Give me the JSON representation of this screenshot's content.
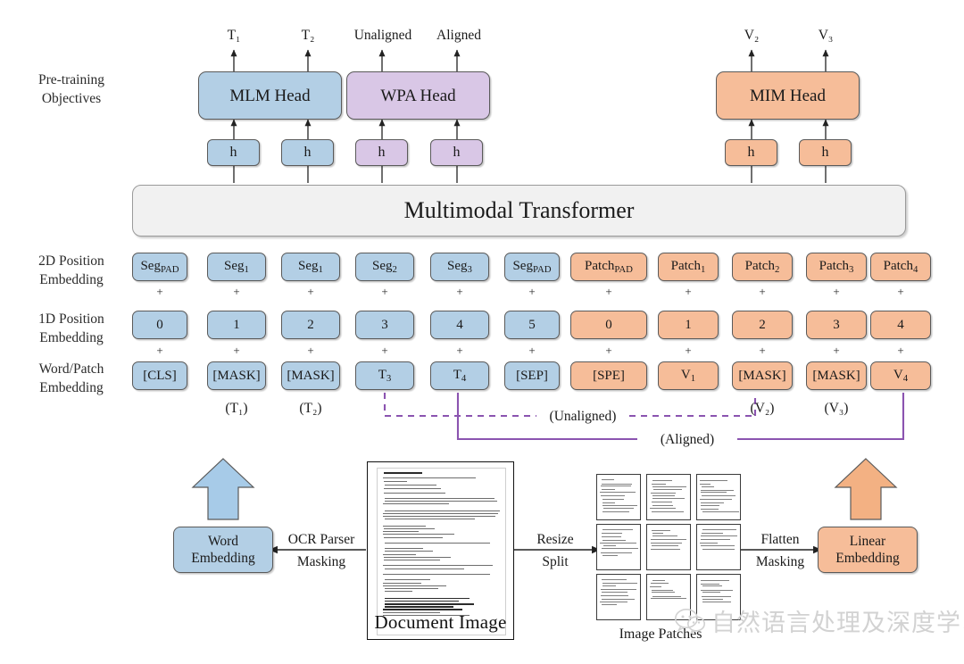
{
  "row_labels": {
    "objectives": "Pre-training\nObjectives",
    "pos2d": "2D Position\nEmbedding",
    "pos1d": "1D Position\nEmbedding",
    "wordpatch": "Word/Patch\nEmbedding"
  },
  "outputs": {
    "t1": "T₁",
    "t2": "T₂",
    "unaligned": "Unaligned",
    "aligned": "Aligned",
    "v2": "V₂",
    "v3": "V₃"
  },
  "heads": [
    {
      "label": "MLM Head",
      "color": "#b3cfe5"
    },
    {
      "label": "WPA Head",
      "color": "#d9c7e6"
    },
    {
      "label": "MIM Head",
      "color": "#f6bd99"
    }
  ],
  "hidden_states": [
    {
      "label": "h",
      "color": "blue"
    },
    {
      "label": "h",
      "color": "blue"
    },
    {
      "label": "h",
      "color": "purple"
    },
    {
      "label": "h",
      "color": "purple"
    },
    {
      "label": "h",
      "color": "orange"
    },
    {
      "label": "h",
      "color": "orange"
    }
  ],
  "transformer": {
    "label": "Multimodal Transformer"
  },
  "text_columns": [
    {
      "seg": "Seg",
      "seg_sub": "PAD",
      "pos": "0",
      "token": "[CLS]",
      "token_sub": "",
      "under": ""
    },
    {
      "seg": "Seg",
      "seg_sub": "1",
      "pos": "1",
      "token": "[MASK]",
      "token_sub": "",
      "under": "(T₁)"
    },
    {
      "seg": "Seg",
      "seg_sub": "1",
      "pos": "2",
      "token": "[MASK]",
      "token_sub": "",
      "under": "(T₂)"
    },
    {
      "seg": "Seg",
      "seg_sub": "2",
      "pos": "3",
      "token": "T",
      "token_sub": "3",
      "under": ""
    },
    {
      "seg": "Seg",
      "seg_sub": "3",
      "pos": "4",
      "token": "T",
      "token_sub": "4",
      "under": ""
    },
    {
      "seg": "Seg",
      "seg_sub": "PAD",
      "pos": "5",
      "token": "[SEP]",
      "token_sub": "",
      "under": ""
    }
  ],
  "image_columns": [
    {
      "patch": "Patch",
      "patch_sub": "PAD",
      "pos": "0",
      "token": "[SPE]",
      "token_sub": "",
      "under": ""
    },
    {
      "patch": "Patch",
      "patch_sub": "1",
      "pos": "1",
      "token": "V",
      "token_sub": "1",
      "under": ""
    },
    {
      "patch": "Patch",
      "patch_sub": "2",
      "pos": "2",
      "token": "[MASK]",
      "token_sub": "",
      "under": "(V₂)"
    },
    {
      "patch": "Patch",
      "patch_sub": "3",
      "pos": "3",
      "token": "[MASK]",
      "token_sub": "",
      "under": "(V₃)"
    },
    {
      "patch": "Patch",
      "patch_sub": "4",
      "pos": "4",
      "token": "V",
      "token_sub": "4",
      "under": ""
    }
  ],
  "plus_symbol": "+",
  "alignment": {
    "unaligned_label": "(Unaligned)",
    "aligned_label": "(Aligned)",
    "line_color": "#8b54b0"
  },
  "pipeline": {
    "word_embedding": "Word\nEmbedding",
    "linear_embedding": "Linear\nEmbedding",
    "ocr_line1": "OCR Parser",
    "ocr_line2": "Masking",
    "resize_line1": "Resize",
    "resize_line2": "Split",
    "flatten_line1": "Flatten",
    "flatten_line2": "Masking",
    "document_caption": "Document Image",
    "patches_caption": "Image Patches"
  },
  "watermark": {
    "text": "自然语言处理及深度学习"
  },
  "colors": {
    "blue": "#b3cfe5",
    "purple": "#d9c7e6",
    "orange": "#f6bd99",
    "grey": "#f1f1f1",
    "stroke": "#5a5a5a",
    "arrow_blue": "#a7cbe8",
    "arrow_orange": "#f3b183",
    "purple_line": "#8b54b0"
  }
}
